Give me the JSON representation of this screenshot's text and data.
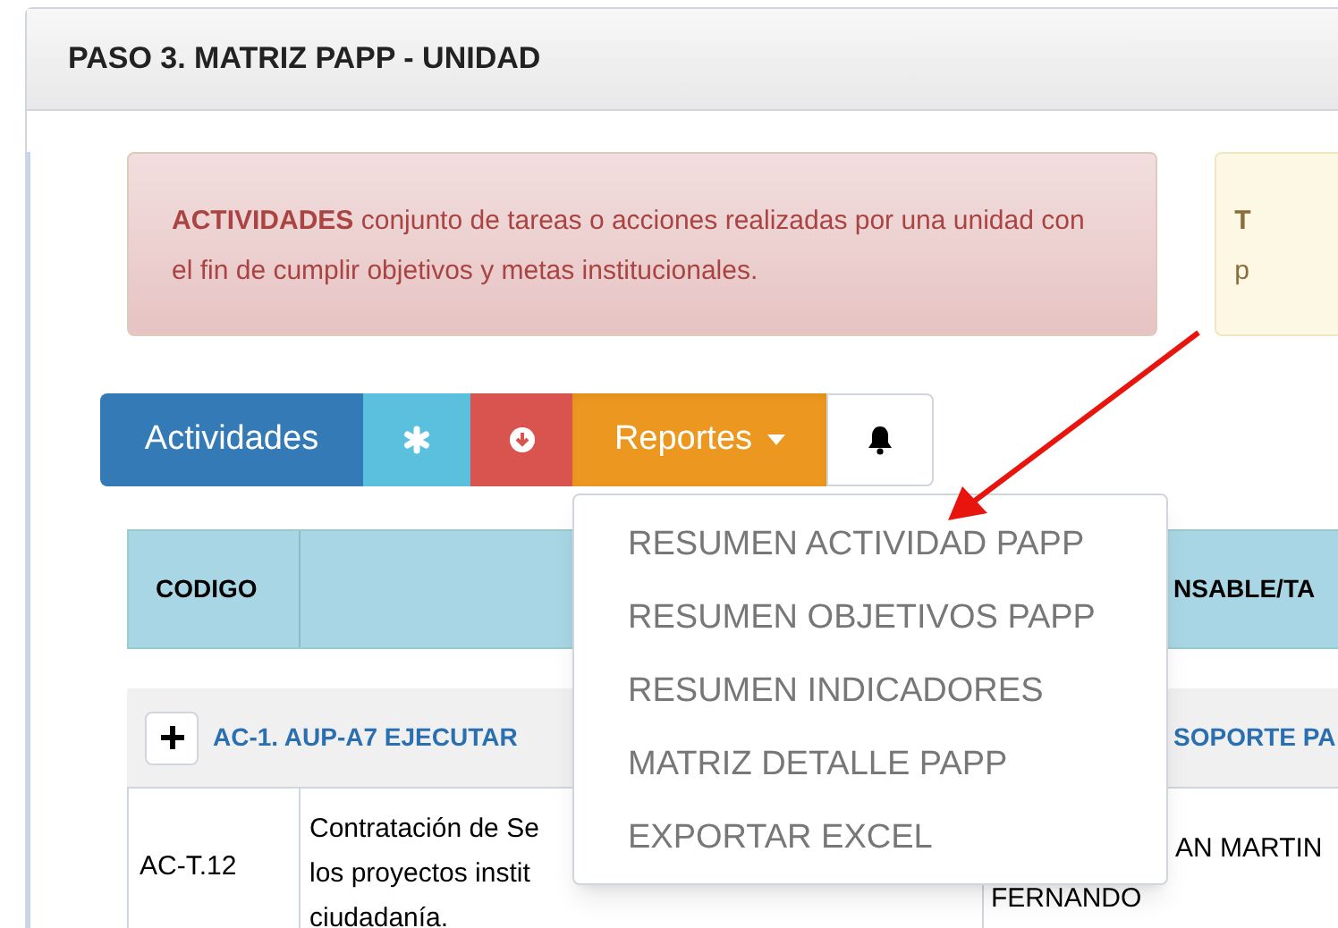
{
  "panel": {
    "title": "PASO 3. MATRIZ PAPP - UNIDAD"
  },
  "alert": {
    "text": "**ACTIVIDADES** conjunto de tareas o acciones realizadas por una unidad con el fin de cumplir objetivos y metas institucionales."
  },
  "side_alert": {
    "title": "T",
    "text": "p"
  },
  "toolbar": [
    {
      "kind": "text",
      "label": "Actividades"
    },
    {
      "kind": "asterisk"
    },
    {
      "kind": "download"
    },
    {
      "kind": "dropdown",
      "label": "Reportes",
      "expanded": true
    },
    {
      "kind": "bell"
    }
  ],
  "menu": [
    "RESUMEN ACTIVIDAD PAPP",
    "RESUMEN OBJETIVOS PAPP",
    "RESUMEN INDICADORES",
    "MATRIZ DETALLE PAPP",
    "EXPORTAR EXCEL"
  ],
  "table": {
    "columns": [
      "CODIGO",
      "NSABLE/TA"
    ],
    "group": {
      "label": "AC-1. AUP-A7 EJECUTAR",
      "column_3": "SOPORTE PA"
    },
    "rows": [
      {
        "code": "AC-T.12",
        "description": [
          "Contratación de Se",
          "los proyectos instit",
          "ciudadanía."
        ],
        "column_3": [
          "AN MARTIN",
          "FERNANDO"
        ]
      }
    ]
  }
}
